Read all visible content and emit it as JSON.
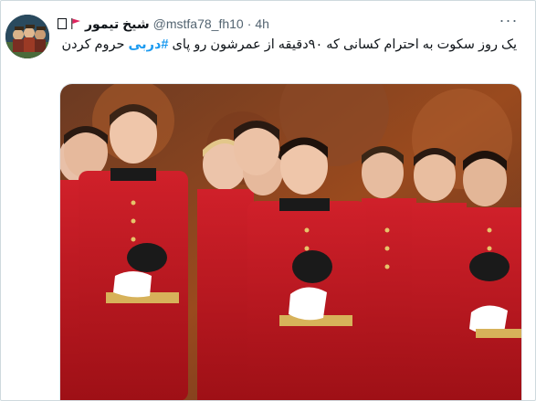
{
  "tweet": {
    "author_name": "شیخ تیمور",
    "handle": "@mstfa78_fh10",
    "separator": "·",
    "time": "4h",
    "more_label": "···",
    "text_before": "یک روز سکوت به احترام کسانی که ۹۰دقیقه از عمرشون رو پای ",
    "hashtag": "#دربی",
    "text_after": " حروم کردن"
  },
  "icons": {
    "flag": "red-flag-icon",
    "box": "empty-box-glyph",
    "more": "more-options-icon"
  },
  "colors": {
    "handle_gray": "#536471",
    "hashtag_blue": "#1d9bf0",
    "uniform_red": "#c8161d",
    "background_autumn": "#8a3a1c"
  }
}
